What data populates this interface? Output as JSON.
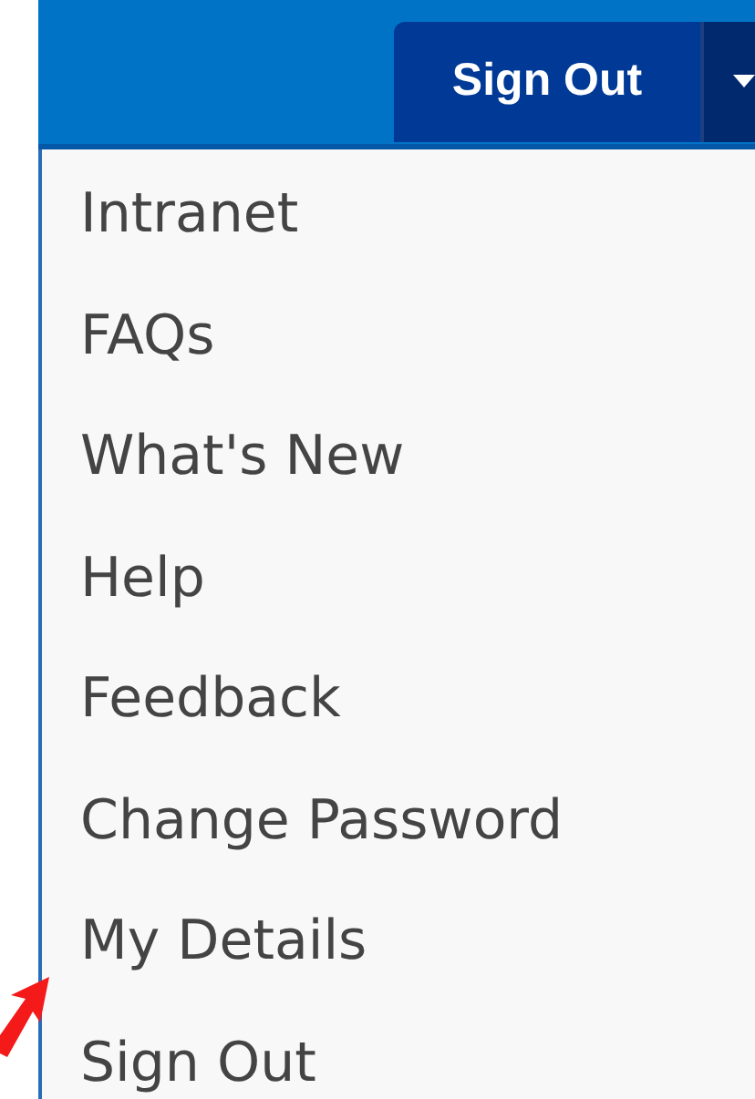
{
  "header": {
    "sign_out_button": "Sign Out"
  },
  "menu": {
    "items": [
      {
        "label": "Intranet"
      },
      {
        "label": "FAQs"
      },
      {
        "label": "What's New"
      },
      {
        "label": "Help"
      },
      {
        "label": "Feedback"
      },
      {
        "label": "Change Password"
      },
      {
        "label": "My Details"
      },
      {
        "label": "Sign Out"
      }
    ]
  }
}
